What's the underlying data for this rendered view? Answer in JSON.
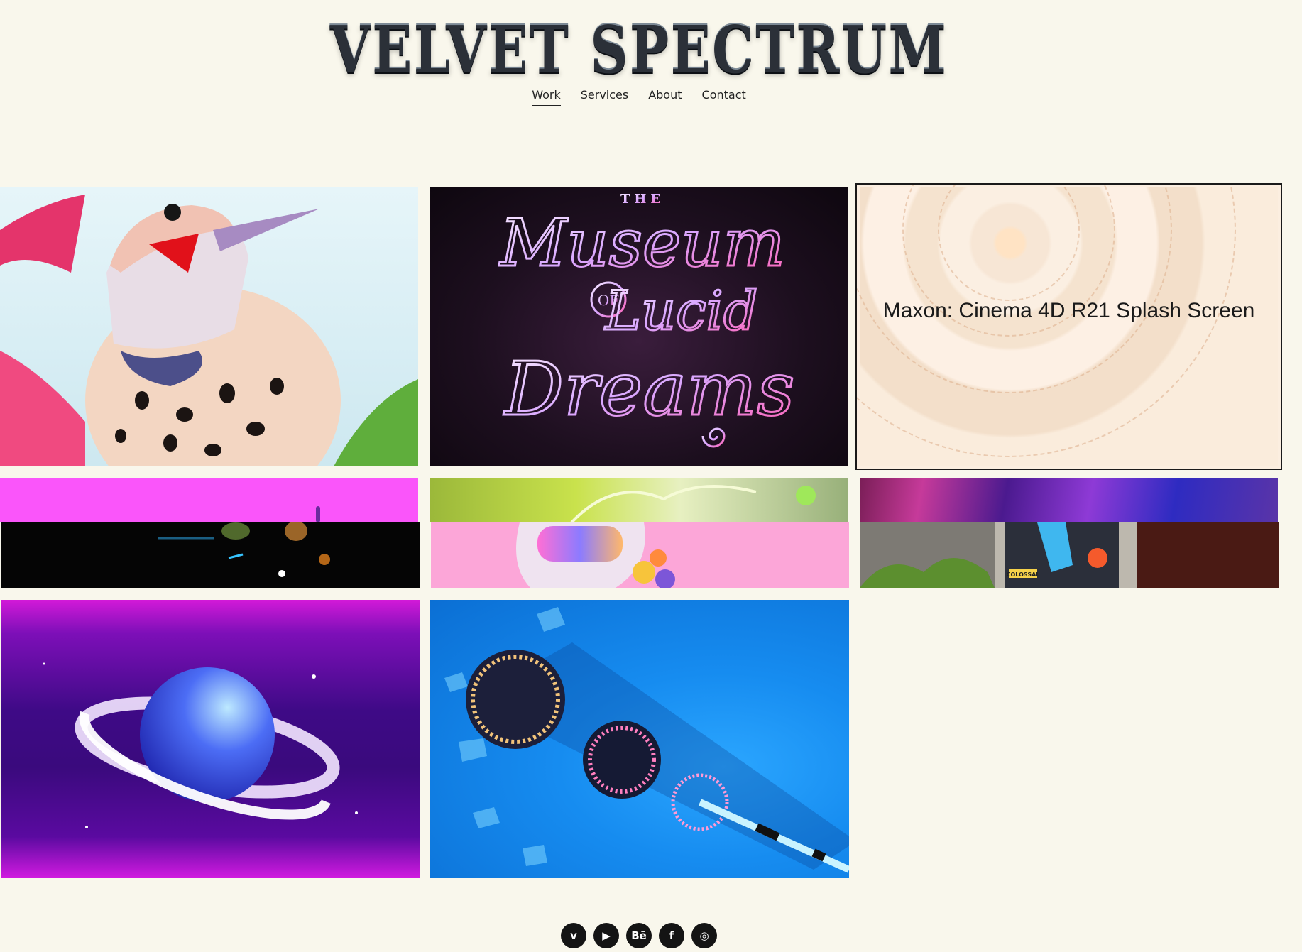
{
  "brand": {
    "logo_text": "VELVET SPECTRUM"
  },
  "nav": {
    "items": [
      {
        "label": "Work",
        "active": true
      },
      {
        "label": "Services",
        "active": false
      },
      {
        "label": "About",
        "active": false
      },
      {
        "label": "Contact",
        "active": false
      }
    ]
  },
  "projects": {
    "hovered_caption": "Maxon: Cinema 4D R21 Splash Screen",
    "museum_artwork_text": [
      "THE",
      "Museum",
      "OF",
      "Lucid",
      "Dreams"
    ],
    "mural_sign_text": "COLOSSAL"
  },
  "social": {
    "icons": [
      {
        "name": "vimeo-icon",
        "glyph": "v"
      },
      {
        "name": "youtube-icon",
        "glyph": "▶"
      },
      {
        "name": "behance-icon",
        "glyph": "Bē"
      },
      {
        "name": "facebook-icon",
        "glyph": "f"
      },
      {
        "name": "instagram-icon",
        "glyph": "◎"
      }
    ]
  },
  "colors": {
    "background": "#f9f7ec",
    "text": "#1a1a1a",
    "hot_pink": "#fa55fa",
    "soft_pink": "#fca6d8",
    "sky_blue": "#168cf0",
    "violet": "#3e0a86"
  }
}
